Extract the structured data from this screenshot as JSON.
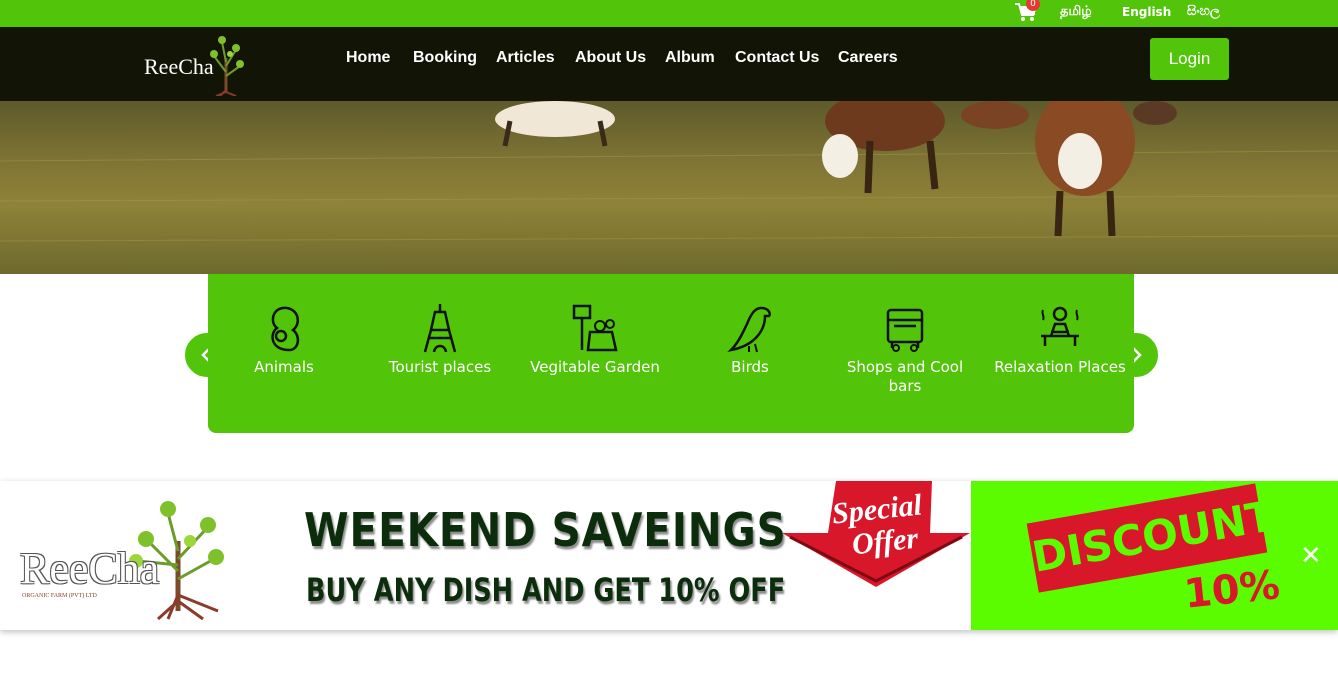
{
  "topbar": {
    "cart_count": "0",
    "languages": [
      "தமிழ்",
      "English",
      "සිංහල"
    ]
  },
  "nav": {
    "logo_text": "ReeCha",
    "items": [
      "Home",
      "Booking",
      "Articles",
      "About Us",
      "Album",
      "Contact Us",
      "Careers"
    ],
    "login_label": "Login"
  },
  "categories": [
    {
      "label": "Animals",
      "icon": "squirrel-icon"
    },
    {
      "label": "Tourist places",
      "icon": "eiffel-tower-icon"
    },
    {
      "label": "Vegitable Garden",
      "icon": "garden-icon"
    },
    {
      "label": "Birds",
      "icon": "bird-icon"
    },
    {
      "label": "Shops and Cool bars",
      "icon": "shop-cart-icon"
    },
    {
      "label": "Relaxation Places",
      "icon": "relaxation-icon"
    }
  ],
  "banner": {
    "logo_text": "ReeCha",
    "logo_subtext": "ORGANIC FARM (PVT) LTD",
    "headline": "WEEKEND SAVEINGS",
    "subline": "BUY ANY DISH AND GET 10% OFF",
    "special_line1": "Special",
    "special_line2": "Offer",
    "discount_label": "DISCOUNT",
    "discount_value": "10%",
    "close_label": "✕"
  },
  "colors": {
    "brand_green": "#52c40a",
    "nav_dark": "#121506",
    "banner_green": "#5cfc00",
    "discount_red": "#d8172a"
  }
}
